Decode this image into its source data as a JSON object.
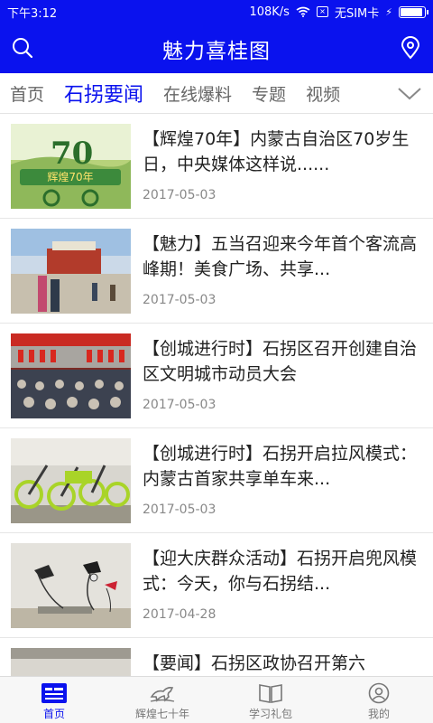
{
  "status_bar": {
    "time": "下午3:12",
    "speed": "108K/s",
    "sim": "无SIM卡"
  },
  "header": {
    "title": "魅力喜桂图"
  },
  "tabs": [
    {
      "label": "首页"
    },
    {
      "label": "石拐要闻"
    },
    {
      "label": "在线爆料"
    },
    {
      "label": "专题"
    },
    {
      "label": "视频"
    }
  ],
  "news": [
    {
      "title": "【辉煌70年】内蒙古自治区70岁生日，中央媒体这样说......",
      "date": "2017-05-03",
      "thumb_text": "辉煌70年"
    },
    {
      "title": "【魅力】五当召迎来今年首个客流高峰期！美食广场、共享...",
      "date": "2017-05-03"
    },
    {
      "title": "【创城进行时】石拐区召开创建自治区文明城市动员大会",
      "date": "2017-05-03"
    },
    {
      "title": "【创城进行时】石拐开启拉风模式：内蒙古首家共享单车来...",
      "date": "2017-05-03"
    },
    {
      "title": "【迎大庆群众活动】石拐开启兜风模式：今天，你与石拐结...",
      "date": "2017-04-28"
    },
    {
      "title": "【要闻】石拐区政协召开第六",
      "date": ""
    }
  ],
  "bottom_nav": [
    {
      "label": "首页"
    },
    {
      "label": "辉煌七十年"
    },
    {
      "label": "学习礼包"
    },
    {
      "label": "我的"
    }
  ],
  "colors": {
    "brand": "#0a12ee",
    "text": "#222222",
    "muted": "#888888"
  }
}
